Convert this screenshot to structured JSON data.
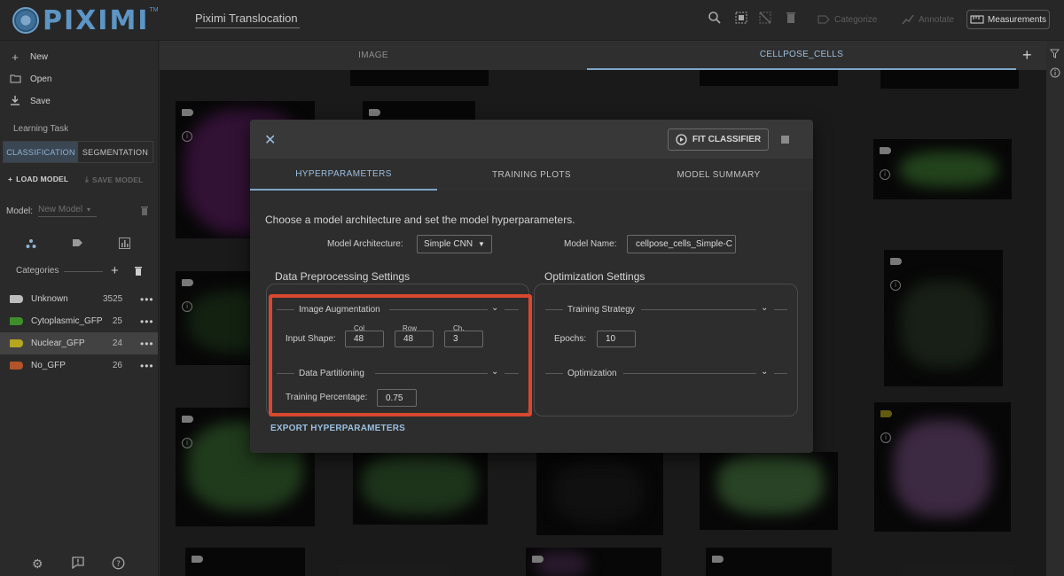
{
  "app": {
    "logo_text": "PIXIMI",
    "logo_tm": "TM",
    "project_name": "Piximi Translocation Tu"
  },
  "toolbar": {
    "categorize_label": "Categorize",
    "annotate_label": "Annotate",
    "measurements_label": "Measurements"
  },
  "sidebar": {
    "new_label": "New",
    "open_label": "Open",
    "save_label": "Save",
    "learning_task_label": "Learning Task",
    "task_tabs": [
      "CLASSIFICATION",
      "SEGMENTATION"
    ],
    "load_model_label": "LOAD MODEL",
    "save_model_label": "SAVE MODEL",
    "model_label": "Model:",
    "model_value": "New Model",
    "categories_label": "Categories",
    "categories": [
      {
        "name": "Unknown",
        "count": "3525",
        "color": "#bdbdbd"
      },
      {
        "name": "Cytoplasmic_GFP",
        "count": "25",
        "color": "#3e8f2a"
      },
      {
        "name": "Nuclear_GFP",
        "count": "24",
        "color": "#b5a51f"
      },
      {
        "name": "No_GFP",
        "count": "26",
        "color": "#b2532a"
      }
    ]
  },
  "image_tabs": [
    "IMAGE",
    "CELLPOSE_CELLS"
  ],
  "dialog": {
    "fit_button_label": "FIT CLASSIFIER",
    "tabs": [
      "HYPERPARAMETERS",
      "TRAINING PLOTS",
      "MODEL SUMMARY"
    ],
    "intro": "Choose a model architecture and set the model hyperparameters.",
    "architecture_label": "Model Architecture:",
    "architecture_value": "Simple CNN",
    "model_name_label": "Model Name:",
    "model_name_value": "cellpose_cells_Simple-C",
    "preprocessing_title": "Data Preprocessing Settings",
    "optimization_title": "Optimization Settings",
    "image_augmentation_label": "Image Augmentation",
    "input_shape_label": "Input Shape:",
    "col_label": "Col",
    "col_value": "48",
    "row_label": "Row",
    "row_value": "48",
    "ch_label": "Ch.",
    "ch_value": "3",
    "data_partitioning_label": "Data Partitioning",
    "training_percentage_label": "Training Percentage:",
    "training_percentage_value": "0.75",
    "training_strategy_label": "Training Strategy",
    "epochs_label": "Epochs:",
    "epochs_value": "10",
    "optimization_label": "Optimization",
    "export_label": "EXPORT HYPERPARAMETERS"
  },
  "colors": {
    "accent": "#9cbfdf",
    "highlight": "#d9482e"
  }
}
